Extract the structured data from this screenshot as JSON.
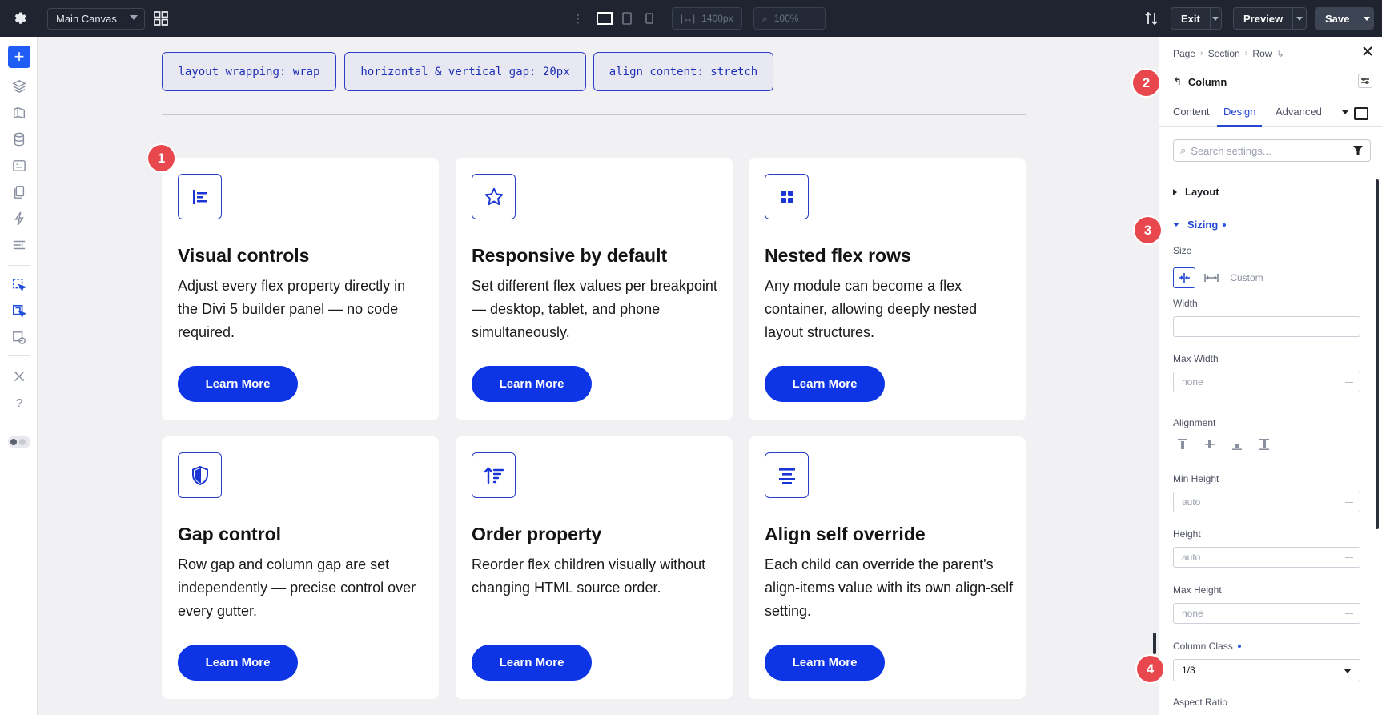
{
  "topbar": {
    "canvas_select": "Main Canvas",
    "width_value": "1400px",
    "zoom_value": "100%",
    "exit_label": "Exit",
    "preview_label": "Preview",
    "save_label": "Save"
  },
  "canvas": {
    "pills": [
      "layout wrapping: wrap",
      "horizontal & vertical gap: 20px",
      "align content: stretch"
    ],
    "cards": [
      {
        "title": "Visual controls",
        "text": "Adjust every flex property directly in the Divi 5 builder panel — no code required.",
        "button": "Learn More",
        "icon": "text-align-left-icon"
      },
      {
        "title": "Responsive by default",
        "text": "Set different flex values per breakpoint — desktop, tablet, and phone simultaneously.",
        "button": "Learn More",
        "icon": "star-icon"
      },
      {
        "title": "Nested flex rows",
        "text": "Any module can become a flex container, allowing deeply nested layout structures.",
        "button": "Learn More",
        "icon": "grid-icon"
      },
      {
        "title": "Gap control",
        "text": "Row gap and column gap are set independently — precise control over every gutter.",
        "button": "Learn More",
        "icon": "shield-icon"
      },
      {
        "title": "Order property",
        "text": "Reorder flex children visually without changing HTML source order.",
        "button": "Learn More",
        "icon": "sort-icon"
      },
      {
        "title": "Align self override",
        "text": "Each child can override the parent's align-items value with its own align-self setting.",
        "button": "Learn More",
        "icon": "text-align-center-icon"
      }
    ],
    "badges": [
      "1",
      "2",
      "3",
      "4"
    ]
  },
  "panel": {
    "breadcrumb": [
      "Page",
      "Section",
      "Row"
    ],
    "title": "Column",
    "tabs": [
      "Content",
      "Design",
      "Advanced"
    ],
    "active_tab": "Design",
    "search_placeholder": "Search settings...",
    "sections": {
      "layout": "Layout",
      "sizing": "Sizing"
    },
    "size_label": "Size",
    "size_custom": "Custom",
    "width_label": "Width",
    "width_value": "",
    "max_width_label": "Max Width",
    "max_width_value": "none",
    "alignment_label": "Alignment",
    "min_height_label": "Min Height",
    "min_height_value": "auto",
    "height_label": "Height",
    "height_value": "auto",
    "max_height_label": "Max Height",
    "max_height_value": "none",
    "column_class_label": "Column Class",
    "column_class_value": "1/3",
    "aspect_ratio_label": "Aspect Ratio"
  },
  "colors": {
    "accent": "#0d35e6",
    "badge": "#e8484d",
    "topbar": "#1f2430"
  }
}
